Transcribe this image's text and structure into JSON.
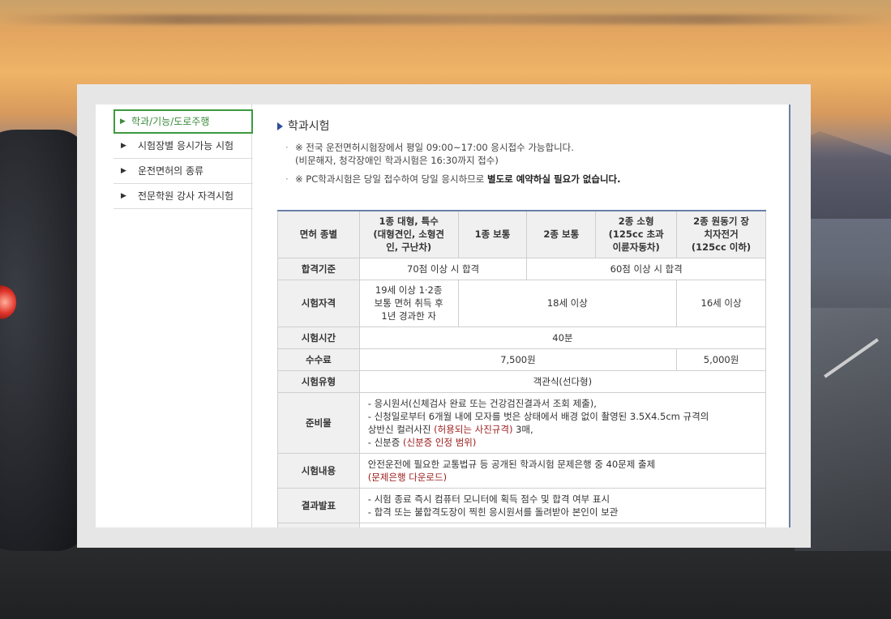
{
  "sidebar": {
    "items": [
      {
        "label": "학과/기능/도로주행",
        "active": true
      },
      {
        "label": "시험장별 응시가능 시험",
        "active": false
      },
      {
        "label": "운전면허의 종류",
        "active": false
      },
      {
        "label": "전문학원 강사 자격시험",
        "active": false
      }
    ]
  },
  "main": {
    "title": "학과시험",
    "notes": {
      "line1a": "※ 전국 운전면허시험장에서 평일 09:00~17:00 응시접수 가능합니다.",
      "line1b": "(비문해자, 청각장애인 학과시험은 16:30까지 접수)",
      "line2_prefix": "※ PC학과시험은 당일 접수하여 당일 응시하므로 ",
      "line2_bold": "별도로 예약하실 필요가 없습니다."
    },
    "table": {
      "header": {
        "col0": "면허 종별",
        "col1a": "1종 대형, 특수",
        "col1b": "(대형견인, 소형견",
        "col1c": "인, 구난차)",
        "col2": "1종 보통",
        "col3": "2종 보통",
        "col4a": "2종 소형",
        "col4b": "(125cc 초과",
        "col4c": "이륜자동차)",
        "col5a": "2종 원동기 장",
        "col5b": "치자전거",
        "col5c": "(125cc 이하)"
      },
      "pass": {
        "label": "합격기준",
        "v1": "70점 이상 시 합격",
        "v2": "60점 이상 시 합격"
      },
      "qual": {
        "label": "시험자격",
        "v1a": "19세 이상 1·2종",
        "v1b": "보통 면허 취득 후",
        "v1c": "1년 경과한 자",
        "v2": "18세 이상",
        "v3": "16세 이상"
      },
      "time": {
        "label": "시험시간",
        "v": "40분"
      },
      "fee": {
        "label": "수수료",
        "v1": "7,500원",
        "v2": "5,000원"
      },
      "type": {
        "label": "시험유형",
        "v": "객관식(선다형)"
      },
      "prep": {
        "label": "준비물",
        "l1": "- 응시원서(신체검사 완료 또는 건강검진결과서 조회 제출),",
        "l2": "- 신청일로부터 6개월 내에 모자를 벗은 상태에서 배경 없이 촬영된 3.5X4.5cm 규격의",
        "l3a": "상반신 컬러사진 ",
        "l3link": "(허용되는 사진규격)",
        "l3b": " 3매,",
        "l4a": "- 신분증 ",
        "l4link": "(신분증 인정 범위)"
      },
      "content": {
        "label": "시험내용",
        "l1": "안전운전에 필요한 교통법규 등 공개된 학과시험 문제은행 중 40문제 출제",
        "link": "(문제은행 다운로드)"
      },
      "result": {
        "label": "결과발표",
        "l1": "- 시험 종료 즉시 컴퓨터 모니터에 획득 점수 및 합격 여부 표시",
        "l2": "- 합격 또는 불합격도장이 찍힌 응시원서를 돌려받아 본인이 보관"
      }
    }
  }
}
